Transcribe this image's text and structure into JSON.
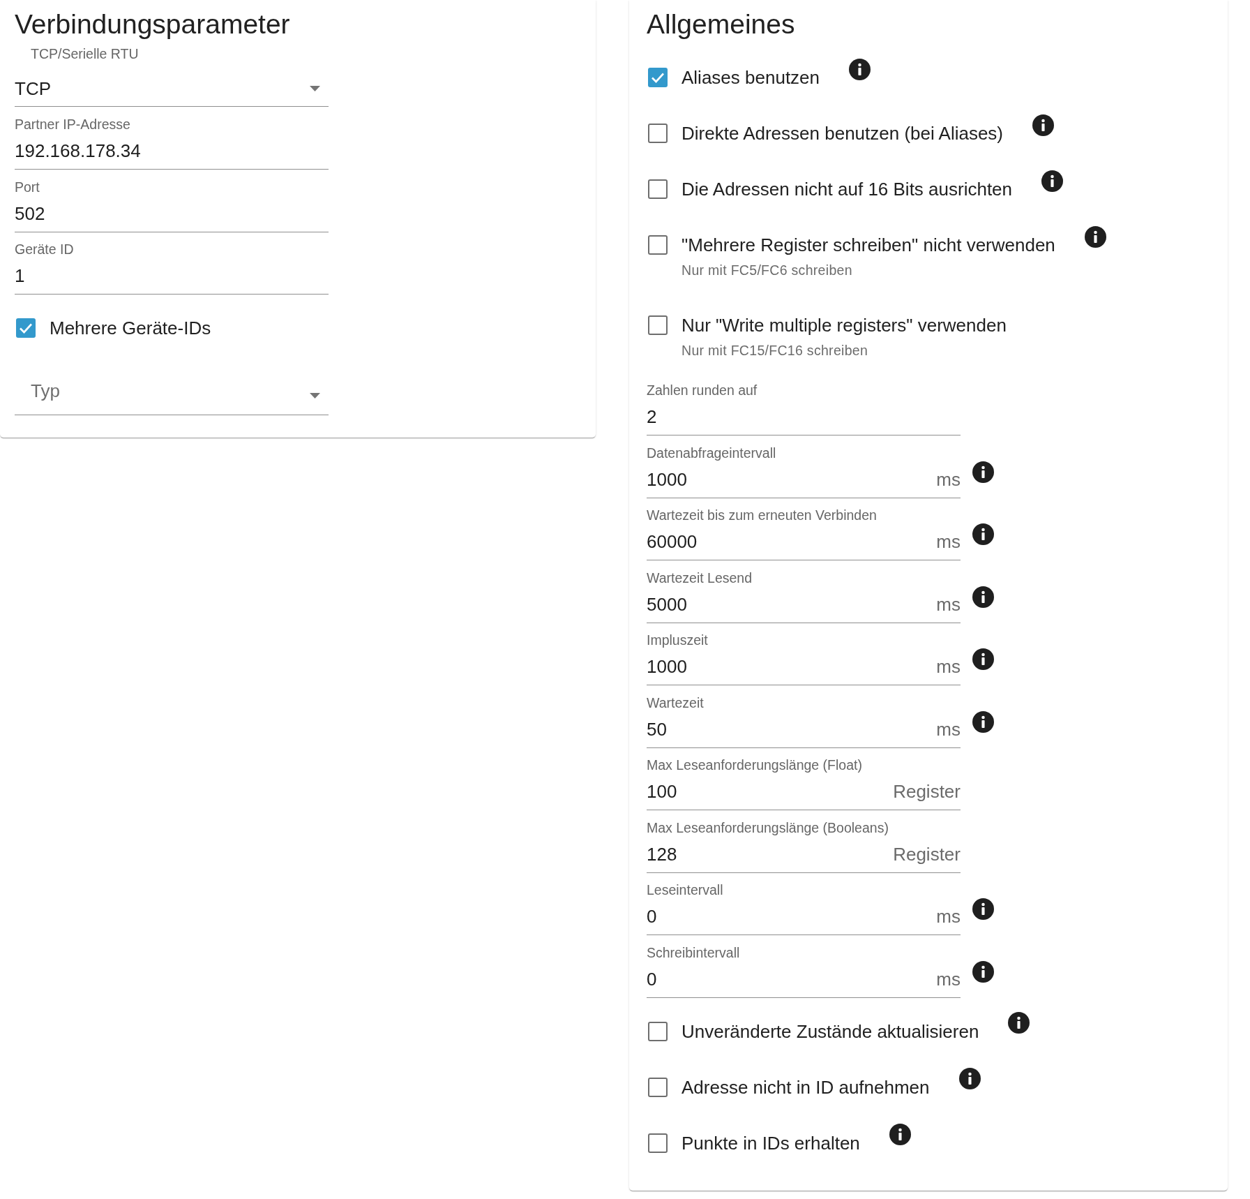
{
  "panels": [
    {
      "title": "Verbindungsparameter",
      "items": [
        {
          "kind": "select",
          "label": "TCP/Serielle RTU",
          "value": "TCP"
        },
        {
          "kind": "field",
          "label": "Partner IP-Adresse",
          "value": "192.168.178.34"
        },
        {
          "kind": "field",
          "label": "Port",
          "value": "502"
        },
        {
          "kind": "field",
          "label": "Geräte ID",
          "value": "1"
        },
        {
          "kind": "checkbox",
          "label": "Mehrere Geräte-IDs",
          "checked": true
        },
        {
          "kind": "select",
          "placeholder": "Typ"
        }
      ]
    },
    {
      "title": "Allgemeines",
      "items": [
        {
          "kind": "checkbox",
          "label": "Aliases benutzen",
          "checked": true,
          "info": true
        },
        {
          "kind": "checkbox",
          "label": "Direkte Adressen benutzen (bei Aliases)",
          "checked": false,
          "info": true
        },
        {
          "kind": "checkbox",
          "label": "Die Adressen nicht auf 16 Bits ausrichten",
          "checked": false,
          "info": true
        },
        {
          "kind": "checkbox",
          "label": "\"Mehrere Register schreiben\" nicht verwenden",
          "checked": false,
          "info": true,
          "help": "Nur mit FC5/FC6 schreiben"
        },
        {
          "kind": "checkbox",
          "label": "Nur \"Write multiple registers\" verwenden",
          "checked": false,
          "help": "Nur mit FC15/FC16 schreiben"
        },
        {
          "kind": "field",
          "label": "Zahlen runden auf",
          "value": "2"
        },
        {
          "kind": "field",
          "label": "Datenabfrageintervall",
          "value": "1000",
          "unit": "ms",
          "info": true
        },
        {
          "kind": "field",
          "label": "Wartezeit bis zum erneuten Verbinden",
          "value": "60000",
          "unit": "ms",
          "info": true
        },
        {
          "kind": "field",
          "label": "Wartezeit Lesend",
          "value": "5000",
          "unit": "ms",
          "info": true
        },
        {
          "kind": "field",
          "label": "Impluszeit",
          "value": "1000",
          "unit": "ms",
          "info": true
        },
        {
          "kind": "field",
          "label": "Wartezeit",
          "value": "50",
          "unit": "ms",
          "info": true
        },
        {
          "kind": "field",
          "label": "Max Leseanforderungslänge (Float)",
          "value": "100",
          "unit": "Register"
        },
        {
          "kind": "field",
          "label": "Max Leseanforderungslänge (Booleans)",
          "value": "128",
          "unit": "Register"
        },
        {
          "kind": "field",
          "label": "Leseintervall",
          "value": "0",
          "unit": "ms",
          "info": true
        },
        {
          "kind": "field",
          "label": "Schreibintervall",
          "value": "0",
          "unit": "ms",
          "info": true
        },
        {
          "kind": "checkbox",
          "label": "Unveränderte Zustände aktualisieren",
          "checked": false,
          "info": true
        },
        {
          "kind": "checkbox",
          "label": "Adresse nicht in ID aufnehmen",
          "checked": false,
          "info": true
        },
        {
          "kind": "checkbox",
          "label": "Punkte in IDs erhalten",
          "checked": false,
          "info": true
        }
      ]
    }
  ]
}
